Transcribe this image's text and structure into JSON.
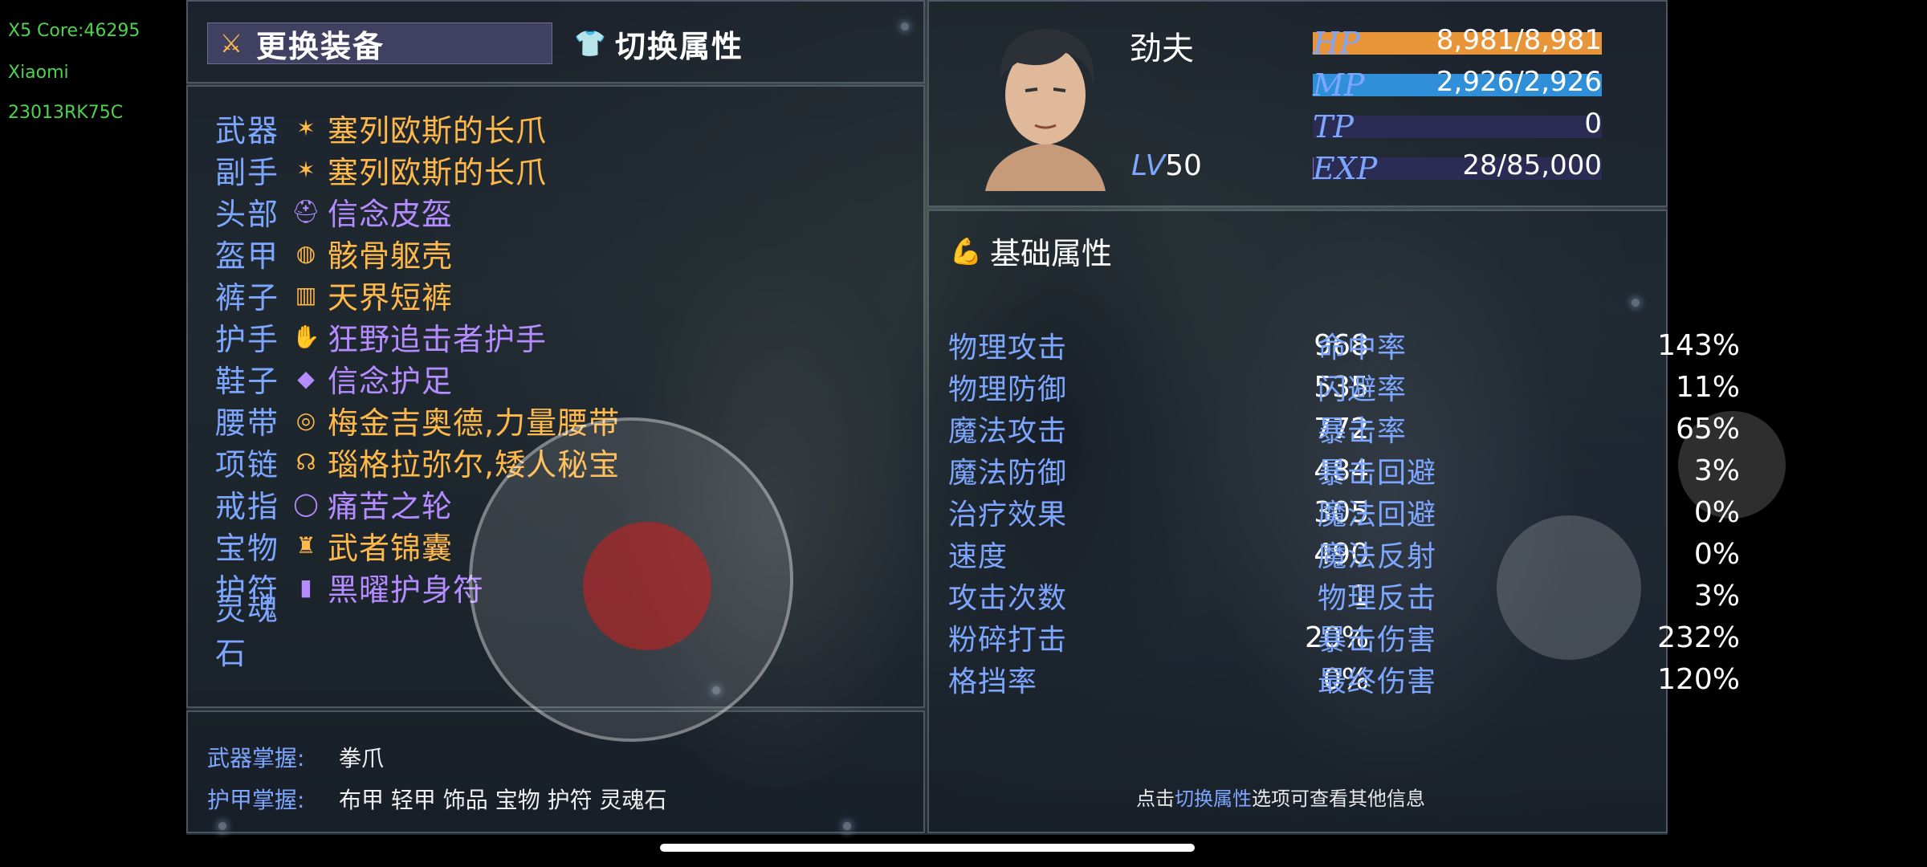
{
  "device": {
    "line1": "X5 Core:46295",
    "line2": "Xiaomi",
    "line3": "23013RK75C"
  },
  "tabs": {
    "equip": "更换装备",
    "attr": "切换属性"
  },
  "equipment": [
    {
      "slot": "武器",
      "name": "塞列欧斯的长爪",
      "color": "#ffb84a",
      "icon": "✶"
    },
    {
      "slot": "副手",
      "name": "塞列欧斯的长爪",
      "color": "#ffb84a",
      "icon": "✶"
    },
    {
      "slot": "头部",
      "name": "信念皮盔",
      "color": "#b48cff",
      "icon": "⛑"
    },
    {
      "slot": "盔甲",
      "name": "骸骨躯壳",
      "color": "#ffb84a",
      "icon": "◍"
    },
    {
      "slot": "裤子",
      "name": "天界短裤",
      "color": "#ffb84a",
      "icon": "▥"
    },
    {
      "slot": "护手",
      "name": "狂野追击者护手",
      "color": "#b48cff",
      "icon": "✋"
    },
    {
      "slot": "鞋子",
      "name": "信念护足",
      "color": "#b48cff",
      "icon": "◆"
    },
    {
      "slot": "腰带",
      "name": "梅金吉奥德,力量腰带",
      "color": "#ffb84a",
      "icon": "◎"
    },
    {
      "slot": "项链",
      "name": "瑙格拉弥尔,矮人秘宝",
      "color": "#ffb84a",
      "icon": "☊"
    },
    {
      "slot": "戒指",
      "name": "痛苦之轮",
      "color": "#b48cff",
      "icon": "◯"
    },
    {
      "slot": "宝物",
      "name": "武者锦囊",
      "color": "#ffb84a",
      "icon": "♜"
    },
    {
      "slot": "护符",
      "name": "黑曜护身符",
      "color": "#b48cff",
      "icon": "▮"
    },
    {
      "slot": "灵魂石",
      "name": "",
      "color": "#ffffff",
      "icon": ""
    }
  ],
  "mastery": {
    "weapon_label": "武器掌握:",
    "weapon_value": "拳爪",
    "armor_label": "护甲掌握:",
    "armor_value": "布甲 轻甲 饰品 宝物 护符 灵魂石"
  },
  "character": {
    "name": "劲夫",
    "lv_label": "LV",
    "lv_value": "50",
    "bars": [
      {
        "label": "HP",
        "value": "8,981/8,981",
        "fill": 1.0,
        "color": "#e8953a"
      },
      {
        "label": "MP",
        "value": "2,926/2,926",
        "fill": 1.0,
        "color": "#2f8fd8"
      },
      {
        "label": "TP",
        "value": "0",
        "fill": 0.0,
        "color": "#8a60d0"
      },
      {
        "label": "EXP",
        "value": "28/85,000",
        "fill": 0.0003,
        "color": "#8a60d0"
      }
    ]
  },
  "stats_title": "基础属性",
  "stats_left": [
    {
      "name": "物理攻击",
      "value": "968"
    },
    {
      "name": "物理防御",
      "value": "535"
    },
    {
      "name": "魔法攻击",
      "value": "772"
    },
    {
      "name": "魔法防御",
      "value": "484"
    },
    {
      "name": "治疗效果",
      "value": "305"
    },
    {
      "name": "速度",
      "value": "490"
    },
    {
      "name": "攻击次数",
      "value": "1"
    },
    {
      "name": "粉碎打击",
      "value": "20%"
    },
    {
      "name": "格挡率",
      "value": "0%"
    }
  ],
  "stats_right": [
    {
      "name": "命中率",
      "value": "143%"
    },
    {
      "name": "闪避率",
      "value": "11%"
    },
    {
      "name": "暴击率",
      "value": "65%"
    },
    {
      "name": "暴击回避",
      "value": "3%"
    },
    {
      "name": "魔法回避",
      "value": "0%"
    },
    {
      "name": "魔法反射",
      "value": "0%"
    },
    {
      "name": "物理反击",
      "value": "3%"
    },
    {
      "name": "暴击伤害",
      "value": "232%"
    },
    {
      "name": "最终伤害",
      "value": "120%"
    }
  ],
  "hint": {
    "pre": "点击",
    "hl": "切换属性",
    "post": "选项可查看其他信息"
  }
}
